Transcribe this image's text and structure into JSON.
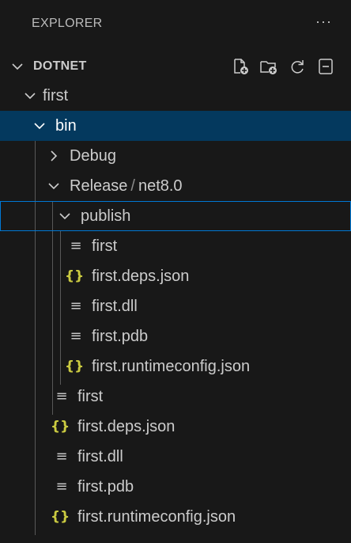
{
  "panel": {
    "title": "EXPLORER",
    "more_actions": "···"
  },
  "section": {
    "title": "DOTNET",
    "actions": [
      "new-file-icon",
      "new-folder-icon",
      "refresh-icon",
      "collapse-all-icon"
    ]
  },
  "tree": {
    "items": [
      {
        "label": "first",
        "type": "folder",
        "expanded": true
      },
      {
        "label": "bin",
        "type": "folder",
        "expanded": true,
        "selected": true
      },
      {
        "label": "Debug",
        "type": "folder",
        "expanded": false
      },
      {
        "label": "Release",
        "label_suffix": "net8.0",
        "type": "folder",
        "expanded": true
      },
      {
        "label": "publish",
        "type": "folder",
        "expanded": true,
        "focused": true
      },
      {
        "label": "first",
        "type": "file",
        "icon": "≡"
      },
      {
        "label": "first.deps.json",
        "type": "json",
        "icon": "{}"
      },
      {
        "label": "first.dll",
        "type": "file",
        "icon": "≡"
      },
      {
        "label": "first.pdb",
        "type": "file",
        "icon": "≡"
      },
      {
        "label": "first.runtimeconfig.json",
        "type": "json",
        "icon": "{}"
      },
      {
        "label": "first",
        "type": "file",
        "icon": "≡"
      },
      {
        "label": "first.deps.json",
        "type": "json",
        "icon": "{}"
      },
      {
        "label": "first.dll",
        "type": "file",
        "icon": "≡"
      },
      {
        "label": "first.pdb",
        "type": "file",
        "icon": "≡"
      },
      {
        "label": "first.runtimeconfig.json",
        "type": "json",
        "icon": "{}"
      }
    ]
  },
  "colors": {
    "background": "#181818",
    "selected_row": "#04395e",
    "focus_border": "#0078d4",
    "json_icon": "#cbcb41",
    "text": "#cccccc"
  }
}
